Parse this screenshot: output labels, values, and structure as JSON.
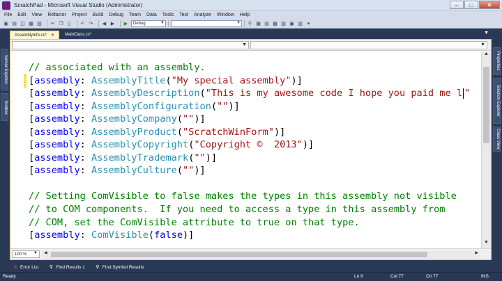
{
  "window": {
    "title": "ScratchPad - Microsoft Visual Studio (Administrator)"
  },
  "menu": [
    "File",
    "Edit",
    "View",
    "Refactor",
    "Project",
    "Build",
    "Debug",
    "Team",
    "Data",
    "Tools",
    "Test",
    "Analyze",
    "Window",
    "Help"
  ],
  "toolbar": {
    "config": "Debug",
    "platform": ""
  },
  "left_tabs": [
    "Server Explorer",
    "Toolbox"
  ],
  "right_tabs": [
    "Properties",
    "Solution Explorer",
    "Class View"
  ],
  "tabs": [
    {
      "label": "AssemblyInfo.cs*",
      "active": true
    },
    {
      "label": "MainClass.cs*",
      "active": false
    }
  ],
  "editor": {
    "lines": [
      [
        [
          "cm",
          "// associated with an assembly."
        ]
      ],
      [
        [
          "pl",
          "["
        ],
        [
          "kw",
          "assembly"
        ],
        [
          "pl",
          ": "
        ],
        [
          "ty",
          "AssemblyTitle"
        ],
        [
          "pl",
          "("
        ],
        [
          "st",
          "\"My special assembly\""
        ],
        [
          "pl",
          ")]"
        ]
      ],
      [
        [
          "pl",
          "["
        ],
        [
          "kw",
          "assembly"
        ],
        [
          "pl",
          ": "
        ],
        [
          "ty",
          "AssemblyDescription"
        ],
        [
          "pl",
          "("
        ],
        [
          "st",
          "\"This is my awesome code I hope you paid me l"
        ],
        [
          "caret",
          ""
        ],
        [
          "st",
          "\""
        ]
      ],
      [
        [
          "pl",
          "["
        ],
        [
          "kw",
          "assembly"
        ],
        [
          "pl",
          ": "
        ],
        [
          "ty",
          "AssemblyConfiguration"
        ],
        [
          "pl",
          "("
        ],
        [
          "st",
          "\"\""
        ],
        [
          "pl",
          ")]"
        ]
      ],
      [
        [
          "pl",
          "["
        ],
        [
          "kw",
          "assembly"
        ],
        [
          "pl",
          ": "
        ],
        [
          "ty",
          "AssemblyCompany"
        ],
        [
          "pl",
          "("
        ],
        [
          "st",
          "\"\""
        ],
        [
          "pl",
          ")]"
        ]
      ],
      [
        [
          "pl",
          "["
        ],
        [
          "kw",
          "assembly"
        ],
        [
          "pl",
          ": "
        ],
        [
          "ty",
          "AssemblyProduct"
        ],
        [
          "pl",
          "("
        ],
        [
          "st",
          "\"ScratchWinForm\""
        ],
        [
          "pl",
          ")]"
        ]
      ],
      [
        [
          "pl",
          "["
        ],
        [
          "kw",
          "assembly"
        ],
        [
          "pl",
          ": "
        ],
        [
          "ty",
          "AssemblyCopyright"
        ],
        [
          "pl",
          "("
        ],
        [
          "st",
          "\"Copyright ©  2013\""
        ],
        [
          "pl",
          ")]"
        ]
      ],
      [
        [
          "pl",
          "["
        ],
        [
          "kw",
          "assembly"
        ],
        [
          "pl",
          ": "
        ],
        [
          "ty",
          "AssemblyTrademark"
        ],
        [
          "pl",
          "("
        ],
        [
          "st",
          "\"\""
        ],
        [
          "pl",
          ")]"
        ]
      ],
      [
        [
          "pl",
          "["
        ],
        [
          "kw",
          "assembly"
        ],
        [
          "pl",
          ": "
        ],
        [
          "ty",
          "AssemblyCulture"
        ],
        [
          "pl",
          "("
        ],
        [
          "st",
          "\"\""
        ],
        [
          "pl",
          ")]"
        ]
      ],
      [
        [
          "pl",
          ""
        ]
      ],
      [
        [
          "cm",
          "// Setting ComVisible to false makes the types in this assembly not visible"
        ]
      ],
      [
        [
          "cm",
          "// to COM components.  If you need to access a type in this assembly from"
        ]
      ],
      [
        [
          "cm",
          "// COM, set the ComVisible attribute to true on that type."
        ]
      ],
      [
        [
          "pl",
          "["
        ],
        [
          "kw",
          "assembly"
        ],
        [
          "pl",
          ": "
        ],
        [
          "ty",
          "ComVisible"
        ],
        [
          "pl",
          "("
        ],
        [
          "kw",
          "false"
        ],
        [
          "pl",
          ")]"
        ]
      ]
    ],
    "zoom": "100 %"
  },
  "bottom_tabs": [
    "Error List",
    "Find Results 1",
    "Find Symbol Results"
  ],
  "status": {
    "ready": "Ready",
    "ln": "Ln 9",
    "col": "Col 77",
    "ch": "Ch 77",
    "mode": "INS"
  }
}
